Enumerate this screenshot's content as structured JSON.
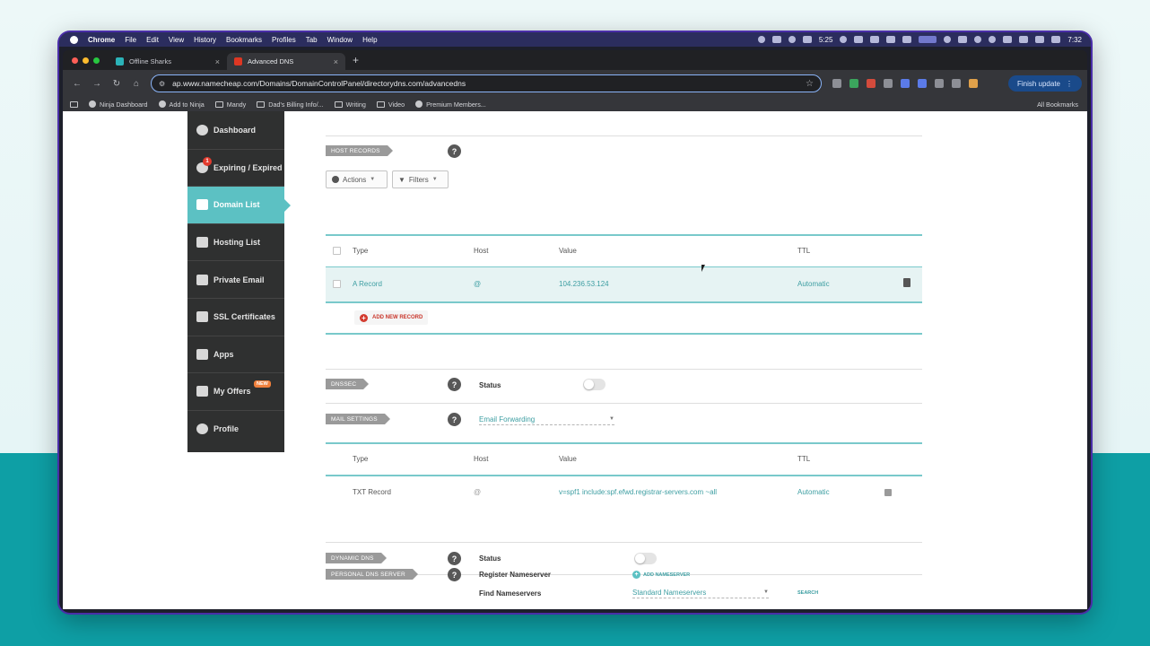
{
  "menubar": {
    "app": "Chrome",
    "items": [
      "File",
      "Edit",
      "View",
      "History",
      "Bookmarks",
      "Profiles",
      "Tab",
      "Window",
      "Help"
    ],
    "status_time": "5:25",
    "clock": "7:32"
  },
  "tabs": [
    {
      "title": "Offline Sharks",
      "icon": "shark-favicon"
    },
    {
      "title": "Advanced DNS",
      "icon": "namecheap-favicon"
    }
  ],
  "toolbar": {
    "url": "ap.www.namecheap.com/Domains/DomainControlPanel/directorydns.com/advancedns",
    "finish_update": "Finish update"
  },
  "bookmarks": {
    "items": [
      "Ninja Dashboard",
      "Add to Ninja",
      "Mandy",
      "Dad's Billing Info/...",
      "Writing",
      "Video",
      "Premium Members..."
    ],
    "all": "All Bookmarks"
  },
  "sidebar": {
    "items": [
      {
        "label": "Dashboard"
      },
      {
        "label": "Expiring / Expired",
        "badge": "1"
      },
      {
        "label": "Domain List"
      },
      {
        "label": "Hosting List"
      },
      {
        "label": "Private Email"
      },
      {
        "label": "SSL Certificates"
      },
      {
        "label": "Apps"
      },
      {
        "label": "My Offers",
        "badge": "NEW"
      },
      {
        "label": "Profile"
      }
    ]
  },
  "host_records": {
    "label": "HOST RECORDS",
    "actions": "Actions",
    "filters": "Filters",
    "columns": [
      "Type",
      "Host",
      "Value",
      "TTL"
    ],
    "rows": [
      {
        "type": "A Record",
        "host": "@",
        "value": "104.236.53.124",
        "ttl": "Automatic"
      }
    ],
    "add_new": "ADD NEW RECORD"
  },
  "dnssec": {
    "label": "DNSSEC",
    "status_label": "Status"
  },
  "mail": {
    "label": "MAIL SETTINGS",
    "selected": "Email Forwarding",
    "columns": [
      "Type",
      "Host",
      "Value",
      "TTL"
    ],
    "rows": [
      {
        "type": "TXT Record",
        "host": "@",
        "value": "v=spf1 include:spf.efwd.registrar-servers.com ~all",
        "ttl": "Automatic"
      }
    ]
  },
  "dynamic_dns": {
    "label": "DYNAMIC DNS",
    "status_label": "Status"
  },
  "personal_dns": {
    "label": "PERSONAL DNS SERVER",
    "register_label": "Register Nameserver",
    "add_nameserver": "ADD NAMESERVER",
    "find_label": "Find Nameservers",
    "selected": "Standard Nameservers",
    "search": "SEARCH"
  },
  "colors": {
    "accent": "#5cc1c3",
    "sidebar": "#2f3030",
    "danger": "#d33a2e",
    "background_bottom": "#0e9fa5"
  }
}
